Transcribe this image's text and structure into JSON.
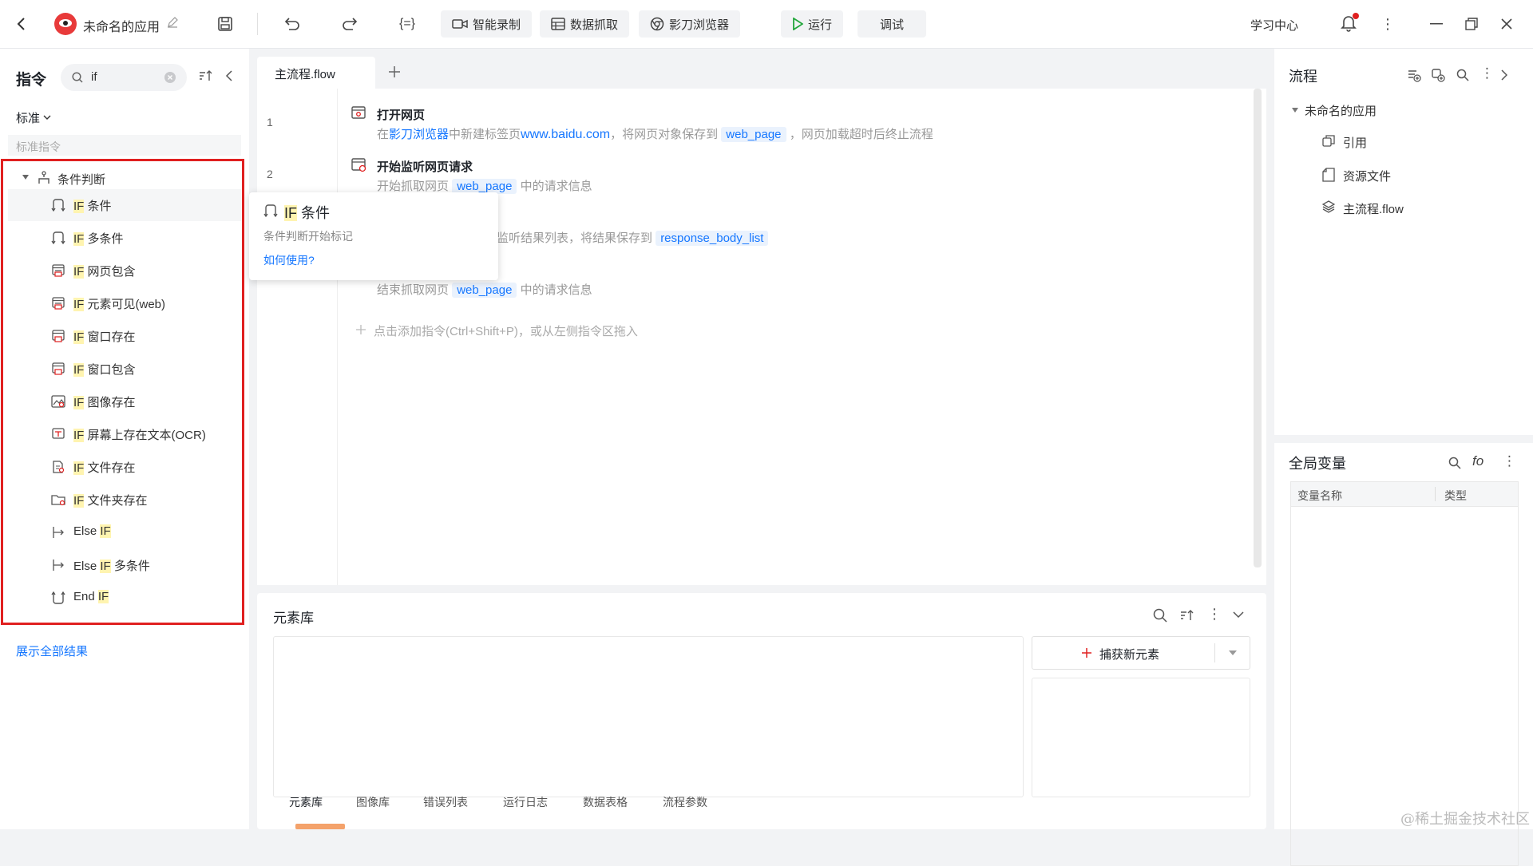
{
  "topbar": {
    "app_name": "未命名的应用",
    "btn_smart_record": "智能录制",
    "btn_data_scrape": "数据抓取",
    "btn_browser": "影刀浏览器",
    "btn_run": "运行",
    "btn_debug": "调试",
    "learning_center": "学习中心"
  },
  "left": {
    "title": "指令",
    "search_value": "if",
    "filter_label": "标准",
    "section_label": "标准指令",
    "group_label": "条件判断",
    "items": [
      {
        "prefix": "IF",
        "suffix": " 条件",
        "icon": "if-branch-icon"
      },
      {
        "prefix": "IF",
        "suffix": " 多条件",
        "icon": "if-branch-icon"
      },
      {
        "prefix": "IF",
        "suffix": " 网页包含",
        "icon": "web-page-icon"
      },
      {
        "prefix": "IF",
        "suffix": " 元素可见(web)",
        "icon": "web-page-icon"
      },
      {
        "prefix": "IF",
        "suffix": " 窗口存在",
        "icon": "window-icon"
      },
      {
        "prefix": "IF",
        "suffix": " 窗口包含",
        "icon": "window-icon"
      },
      {
        "prefix": "IF",
        "suffix": " 图像存在",
        "icon": "image-icon"
      },
      {
        "prefix": "IF",
        "suffix": " 屏幕上存在文本(OCR)",
        "icon": "ocr-icon"
      },
      {
        "prefix": "IF",
        "suffix": " 文件存在",
        "icon": "file-icon"
      },
      {
        "prefix": "IF",
        "suffix": " 文件夹存在",
        "icon": "folder-icon"
      },
      {
        "prefix": "Else ",
        "suffix": "IF",
        "icon": "else-if-icon",
        "hl_suffix": true
      },
      {
        "prefix": "Else ",
        "suffix": "IF",
        "extra": " 多条件",
        "icon": "else-if-icon",
        "hl_suffix": true
      },
      {
        "prefix": "End ",
        "suffix": "IF",
        "icon": "end-if-icon",
        "hl_suffix": true
      }
    ],
    "show_all": "展示全部结果"
  },
  "editor": {
    "tab_label": "主流程.flow",
    "steps": [
      {
        "num": "1",
        "title": "打开网页"
      },
      {
        "num": "2",
        "title": "开始监听网页请求"
      }
    ],
    "step1_desc_a": "在",
    "step1_desc_link": "影刀浏览器",
    "step1_desc_b": "中新建标签页",
    "step1_desc_url": "www.baidu.com",
    "step1_desc_c": "，将网页对象保存到",
    "step1_var": "web_page",
    "step1_desc_d": "，网页加载超时后终止流程",
    "step2_desc_a": "开始抓取网页",
    "step2_var": "web_page",
    "step2_desc_b": "中的请求信息",
    "step3_desc_a": "监听结果列表，将结果保存到",
    "step3_var": "response_body_list",
    "step4_desc_a": "结束抓取网页",
    "step4_var": "web_page",
    "step4_desc_b": "中的请求信息",
    "add_hint": "点击添加指令(Ctrl+Shift+P)，或从左侧指令区拖入"
  },
  "tooltip": {
    "title_prefix": "IF",
    "title_suffix": " 条件",
    "desc": "条件判断开始标记",
    "link": "如何使用?"
  },
  "element_lib": {
    "title": "元素库",
    "capture_btn": "捕获新元素",
    "tabs": [
      "元素库",
      "图像库",
      "错误列表",
      "运行日志",
      "数据表格",
      "流程参数"
    ]
  },
  "flow_panel": {
    "title": "流程",
    "root": "未命名的应用",
    "children": [
      "引用",
      "资源文件",
      "主流程.flow"
    ]
  },
  "globals": {
    "title": "全局变量",
    "col_name": "变量名称",
    "col_type": "类型"
  },
  "watermark": "@稀土掘金技术社区",
  "colors": {
    "accent": "#1677ff",
    "highlight": "#fff4b0",
    "red_box": "#e02020",
    "run_green": "#22a63b"
  }
}
